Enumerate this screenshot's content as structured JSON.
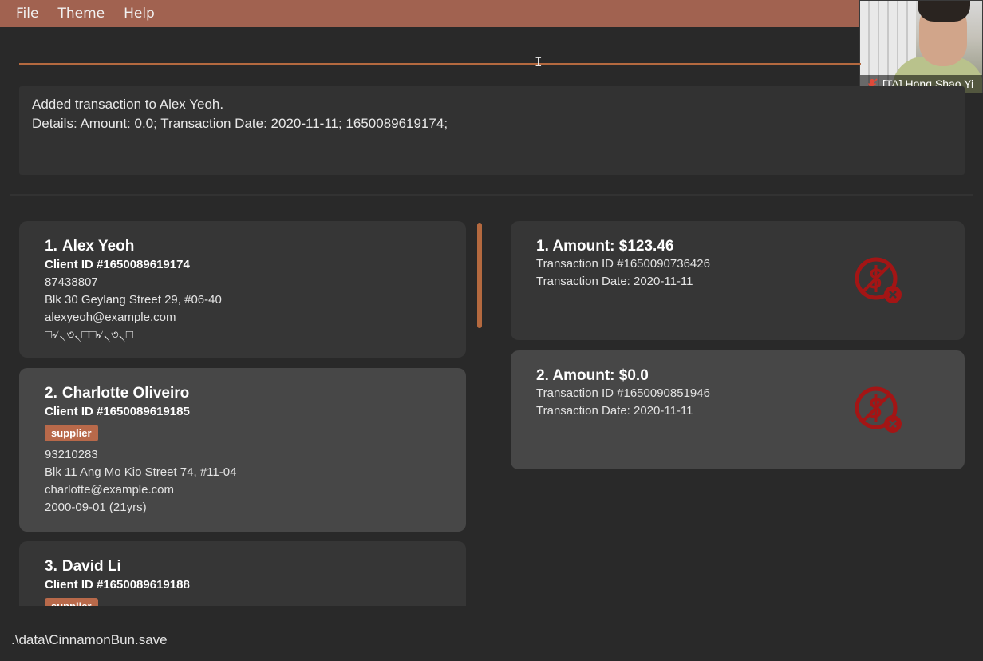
{
  "menubar": {
    "items": [
      "File",
      "Theme",
      "Help"
    ]
  },
  "video_call": {
    "participant_label": "[TA] Hong Shao Yi"
  },
  "command_box": {
    "value": ""
  },
  "result_display": {
    "text": "Added transaction to Alex Yeoh.\nDetails: Amount: 0.0; Transaction Date: 2020-11-11; 1650089619174;"
  },
  "clients": [
    {
      "index": "1.",
      "name": "Alex Yeoh",
      "client_id": "Client ID #1650089619174",
      "tags": [],
      "phone": "87438807",
      "address": "Blk 30 Geylang Street 29, #06-40",
      "email": "alexyeoh@example.com",
      "extra": "□৵৲৩৲□□৵৲৩৲□"
    },
    {
      "index": "2.",
      "name": "Charlotte Oliveiro",
      "client_id": "Client ID #1650089619185",
      "tags": [
        "supplier"
      ],
      "phone": "93210283",
      "address": "Blk 11 Ang Mo Kio Street 74, #11-04",
      "email": "charlotte@example.com",
      "extra": "2000-09-01 (21yrs)"
    },
    {
      "index": "3.",
      "name": "David Li",
      "client_id": "Client ID #1650089619188",
      "tags": [
        "supplier"
      ]
    }
  ],
  "transactions": [
    {
      "title": "1. Amount: $123.46",
      "transaction_id": "Transaction ID #1650090736426",
      "date": "Transaction Date: 2020-11-11",
      "status_icon": "unpaid-icon"
    },
    {
      "title": "2. Amount: $0.0",
      "transaction_id": "Transaction ID #1650090851946",
      "date": "Transaction Date: 2020-11-11",
      "status_icon": "unpaid-icon"
    }
  ],
  "status_bar": {
    "save_path": ".\\data\\CinnamonBun.save"
  },
  "colors": {
    "accent": "#b4693f",
    "menubar": "#a16250",
    "background": "#292929",
    "card": "#363636",
    "card_selected": "#474747",
    "unpaid_icon": "#a31515"
  }
}
